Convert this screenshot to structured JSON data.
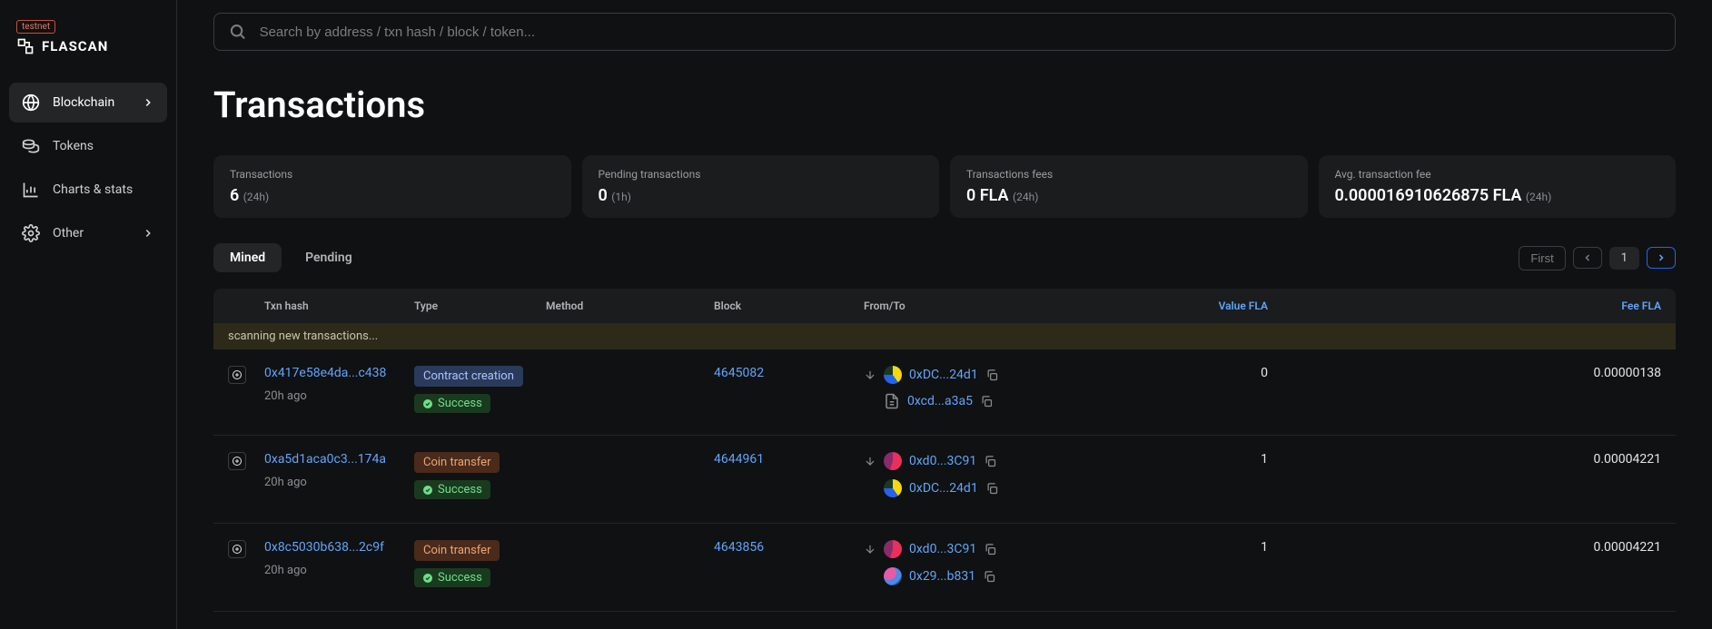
{
  "header": {
    "badge": "testnet",
    "brand": "FLASCAN"
  },
  "sidebar": {
    "items": [
      {
        "label": "Blockchain",
        "icon": "globe-icon",
        "active": true,
        "chevron": true
      },
      {
        "label": "Tokens",
        "icon": "coins-icon",
        "active": false,
        "chevron": false
      },
      {
        "label": "Charts & stats",
        "icon": "chart-icon",
        "active": false,
        "chevron": false
      },
      {
        "label": "Other",
        "icon": "gear-icon",
        "active": false,
        "chevron": true
      }
    ]
  },
  "search": {
    "placeholder": "Search by address / txn hash / block / token..."
  },
  "page_title": "Transactions",
  "stats": [
    {
      "label": "Transactions",
      "value": "6",
      "suffix": "(24h)"
    },
    {
      "label": "Pending transactions",
      "value": "0",
      "suffix": "(1h)"
    },
    {
      "label": "Transactions fees",
      "value": "0 FLA",
      "suffix": "(24h)"
    },
    {
      "label": "Avg. transaction fee",
      "value": "0.000016910626875 FLA",
      "suffix": "(24h)"
    }
  ],
  "tabs": {
    "mined": "Mined",
    "pending": "Pending",
    "active": "mined"
  },
  "pagination": {
    "first": "First",
    "page": "1"
  },
  "table": {
    "headers": {
      "hash": "Txn hash",
      "type": "Type",
      "method": "Method",
      "block": "Block",
      "fromto": "From/To",
      "value": "Value FLA",
      "fee": "Fee FLA"
    },
    "scanning": "scanning new transactions...",
    "rows": [
      {
        "hash": "0x417e58e4da...c438",
        "time": "20h ago",
        "type": "Contract creation",
        "type_class": "contract",
        "status": "Success",
        "block": "4645082",
        "from": "0xDC...24d1",
        "from_avatar": "yb",
        "to": "0xcd...a3a5",
        "to_is_contract": true,
        "value": "0",
        "fee": "0.00000138"
      },
      {
        "hash": "0xa5d1aca0c3...174a",
        "time": "20h ago",
        "type": "Coin transfer",
        "type_class": "transfer",
        "status": "Success",
        "block": "4644961",
        "from": "0xd0...3C91",
        "from_avatar": "rp",
        "to": "0xDC...24d1",
        "to_avatar": "yb",
        "value": "1",
        "fee": "0.00004221"
      },
      {
        "hash": "0x8c5030b638...2c9f",
        "time": "20h ago",
        "type": "Coin transfer",
        "type_class": "transfer",
        "status": "Success",
        "block": "4643856",
        "from": "0xd0...3C91",
        "from_avatar": "rp",
        "to": "0x29...b831",
        "to_avatar": "mp",
        "value": "1",
        "fee": "0.00004221"
      }
    ]
  }
}
